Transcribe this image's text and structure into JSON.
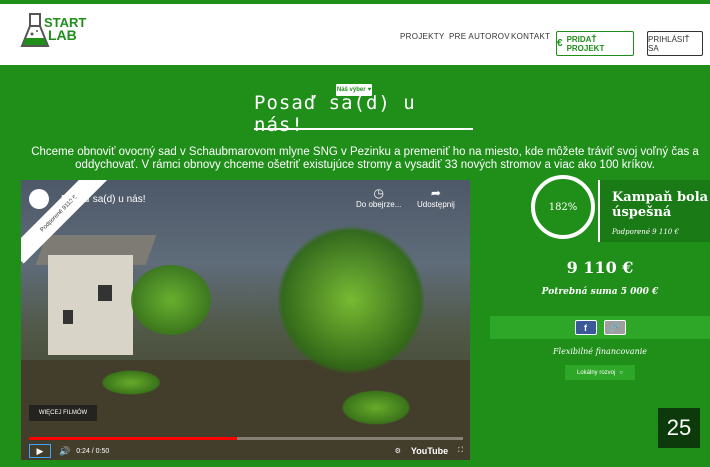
{
  "header": {
    "logo_start": "START",
    "logo_lab": "LAB",
    "nav": [
      {
        "label": "PROJEKTY"
      },
      {
        "label": "PRE AUTOROV"
      },
      {
        "label": "KONTAKT"
      }
    ],
    "add_project_label": "PRIDAŤ PROJEKT",
    "add_project_icon": "€",
    "login_label": "PRIHLÁSIŤ SA"
  },
  "badge": "Náš výber",
  "title": "Posaď sa(d) u nás!",
  "description": "Chceme obnoviť ovocný sad v Schaubmarovom mlyne SNG v Pezinku a premeniť ho na miesto, kde môžete tráviť svoj voľný čas a oddychovať. V rámci obnovy chceme ošetriť existujúce stromy a vysadiť 33 nových stromov a viac ako 100 kríkov.",
  "video": {
    "ribbon": "Podporené 9110 €",
    "title": "Posaď sa(d) u nás!",
    "watch_later": "Do obejrze...",
    "share": "Udostępnij",
    "more_films": "WIĘCEJ FILMÓW",
    "time": "0:24 / 0:50",
    "progress": 0.48,
    "youtube": "YouTube"
  },
  "campaign": {
    "percent": "182%",
    "status": "Kampaň bola úspešná",
    "supported": "Podporené 9 110 €",
    "amount": "9 110 €",
    "needed": "Potrebná suma 5 000 €",
    "fb": "f",
    "financing": "Flexibilné financovanie",
    "tag": "Lokálny rozvoj"
  },
  "page_number": "25",
  "colors": {
    "brand_green": "#1f8f1a",
    "dark_green": "#0c3a0a"
  }
}
